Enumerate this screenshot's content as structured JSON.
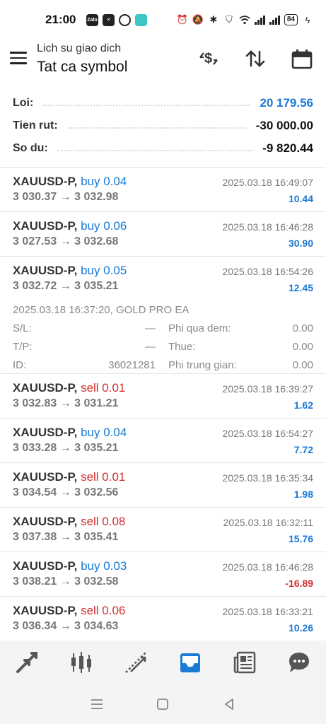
{
  "status": {
    "time": "21:00",
    "app1": "Zalo",
    "battery": "84"
  },
  "header": {
    "subtitle": "Lich su giao dich",
    "title": "Tat ca symbol"
  },
  "summary": {
    "profit_label": "Loi:",
    "profit_value": "20 179.56",
    "withdraw_label": "Tien rut:",
    "withdraw_value": "-30 000.00",
    "balance_label": "So du:",
    "balance_value": "-9 820.44"
  },
  "trades": [
    {
      "symbol": "XAUUSD-P,",
      "side": "buy 0.04",
      "prices": "3 030.37 → 3 032.98",
      "date": "2025.03.18 16:49:07",
      "profit": "10.44"
    },
    {
      "symbol": "XAUUSD-P,",
      "side": "buy 0.06",
      "prices": "3 027.53 → 3 032.68",
      "date": "2025.03.18 16:46:28",
      "profit": "30.90"
    },
    {
      "symbol": "XAUUSD-P,",
      "side": "buy 0.05",
      "prices": "3 032.72 → 3 035.21",
      "date": "2025.03.18 16:54:26",
      "profit": "12.45",
      "details": {
        "info": "2025.03.18 16:37:20, GOLD PRO EA",
        "sl_label": "S/L:",
        "sl_value": "—",
        "swap_label": "Phi qua dem:",
        "swap_value": "0.00",
        "tp_label": "T/P:",
        "tp_value": "—",
        "tax_label": "Thue:",
        "tax_value": "0.00",
        "id_label": "ID:",
        "id_value": "36021281",
        "fee_label": "Phi trung gian:",
        "fee_value": "0.00"
      }
    },
    {
      "symbol": "XAUUSD-P,",
      "side": "sell 0.01",
      "prices": "3 032.83 → 3 031.21",
      "date": "2025.03.18 16:39:27",
      "profit": "1.62"
    },
    {
      "symbol": "XAUUSD-P,",
      "side": "buy 0.04",
      "prices": "3 033.28 → 3 035.21",
      "date": "2025.03.18 16:54:27",
      "profit": "7.72"
    },
    {
      "symbol": "XAUUSD-P,",
      "side": "sell 0.01",
      "prices": "3 034.54 → 3 032.56",
      "date": "2025.03.18 16:35:34",
      "profit": "1.98"
    },
    {
      "symbol": "XAUUSD-P,",
      "side": "sell 0.08",
      "prices": "3 037.38 → 3 035.41",
      "date": "2025.03.18 16:32:11",
      "profit": "15.76"
    },
    {
      "symbol": "XAUUSD-P,",
      "side": "buy 0.03",
      "prices": "3 038.21 → 3 032.58",
      "date": "2025.03.18 16:46:28",
      "profit": "-16.89"
    },
    {
      "symbol": "XAUUSD-P,",
      "side": "sell 0.06",
      "prices": "3 036.34 → 3 034.63",
      "date": "2025.03.18 16:33:21",
      "profit": "10.26"
    }
  ],
  "colors": {
    "buy": "#1a7ad6",
    "sell": "#d32f2f",
    "accent": "#1a7ad6"
  },
  "bottom_nav": [
    "quotes-icon",
    "chart-icon",
    "trade-icon",
    "history-icon",
    "news-icon",
    "chat-icon"
  ]
}
